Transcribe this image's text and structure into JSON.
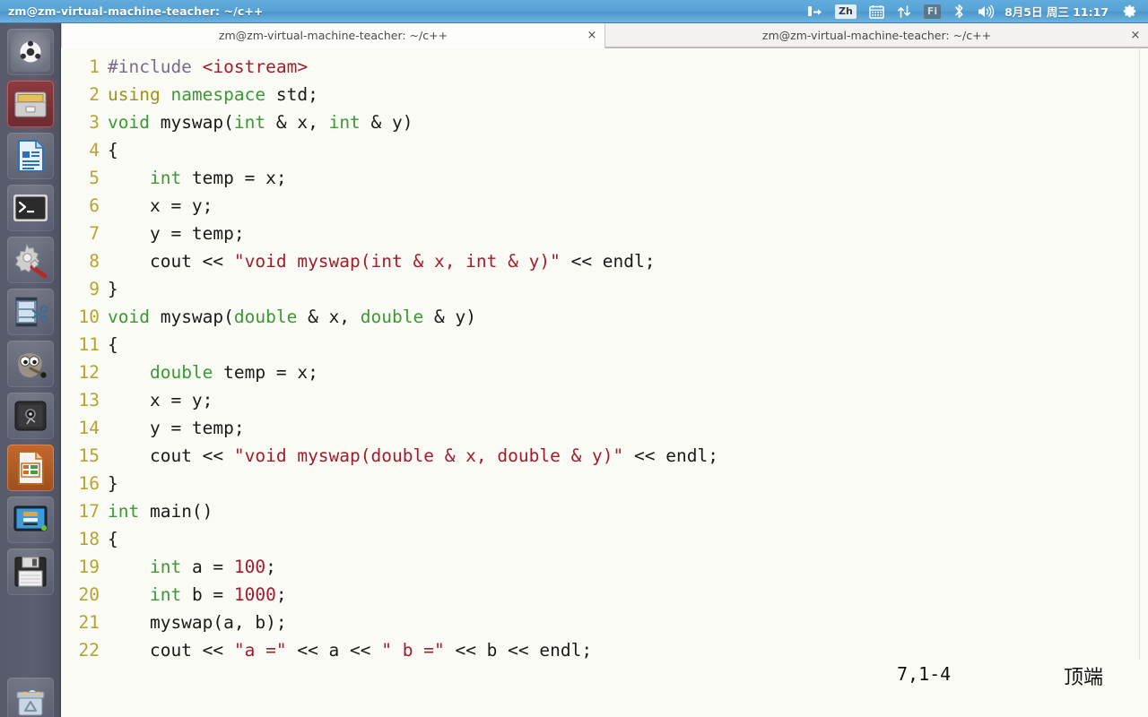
{
  "panel": {
    "window_title": "zm@zm-virtual-machine-teacher: ~/c++",
    "tray": [
      {
        "name": "keyboard-indicator-icon",
        "label": "",
        "kind": "icon"
      },
      {
        "name": "input-method-zh-icon",
        "label": "Zh",
        "kind": "box"
      },
      {
        "name": "calendar-icon",
        "label": "",
        "kind": "icon"
      },
      {
        "name": "network-transfer-icon",
        "label": "",
        "kind": "icon"
      },
      {
        "name": "fcitx-indicator-icon",
        "label": "Fi",
        "kind": "box-dim"
      },
      {
        "name": "bluetooth-icon",
        "label": "",
        "kind": "icon"
      },
      {
        "name": "volume-icon",
        "label": "",
        "kind": "icon"
      }
    ],
    "clock": "8月5日 周三 11:17",
    "session_menu": "gear-icon"
  },
  "launcher": {
    "items": [
      {
        "name": "ubuntu-dash-icon",
        "tooltip": "Dash",
        "state": "normal"
      },
      {
        "name": "files-nautilus-icon",
        "tooltip": "Files",
        "state": "focused"
      },
      {
        "name": "libreoffice-writer-icon",
        "tooltip": "LibreOffice Writer",
        "state": "normal"
      },
      {
        "name": "terminal-icon",
        "tooltip": "Terminal",
        "state": "running"
      },
      {
        "name": "system-settings-icon",
        "tooltip": "System Settings",
        "state": "normal"
      },
      {
        "name": "video-editor-icon",
        "tooltip": "Video Editor",
        "state": "normal"
      },
      {
        "name": "gimp-icon",
        "tooltip": "GIMP",
        "state": "normal"
      },
      {
        "name": "safe-vault-icon",
        "tooltip": "Vault",
        "state": "normal"
      },
      {
        "name": "libreoffice-impress-icon",
        "tooltip": "LibreOffice Impress",
        "state": "focused-orange"
      },
      {
        "name": "remote-desktop-icon",
        "tooltip": "Remote Desktop",
        "state": "normal"
      },
      {
        "name": "floppy-save-icon",
        "tooltip": "Disk",
        "state": "normal"
      },
      {
        "name": "trash-icon",
        "tooltip": "Trash",
        "state": "normal"
      }
    ]
  },
  "terminal": {
    "tabs": [
      {
        "label": "zm@zm-virtual-machine-teacher: ~/c++",
        "active": true,
        "close_label": "×"
      },
      {
        "label": "zm@zm-virtual-machine-teacher: ~/c++",
        "active": false,
        "close_label": "×"
      }
    ],
    "status": {
      "position": "7,1-4",
      "state": "顶端"
    },
    "code_lines": [
      {
        "n": "1",
        "tokens": [
          {
            "t": "#include ",
            "c": "pre"
          },
          {
            "t": "<iostream>",
            "c": "inc"
          }
        ]
      },
      {
        "n": "2",
        "tokens": [
          {
            "t": "using",
            "c": "kw"
          },
          {
            "t": " ",
            "c": "plain"
          },
          {
            "t": "namespace",
            "c": "type"
          },
          {
            "t": " std;",
            "c": "plain"
          }
        ]
      },
      {
        "n": "3",
        "tokens": [
          {
            "t": "void",
            "c": "type"
          },
          {
            "t": " myswap(",
            "c": "plain"
          },
          {
            "t": "int",
            "c": "type"
          },
          {
            "t": " & x, ",
            "c": "plain"
          },
          {
            "t": "int",
            "c": "type"
          },
          {
            "t": " & y)",
            "c": "plain"
          }
        ]
      },
      {
        "n": "4",
        "tokens": [
          {
            "t": "{",
            "c": "plain"
          }
        ]
      },
      {
        "n": "5",
        "tokens": [
          {
            "t": "    ",
            "c": "plain"
          },
          {
            "t": "int",
            "c": "type"
          },
          {
            "t": " temp = x;",
            "c": "plain"
          }
        ]
      },
      {
        "n": "6",
        "tokens": [
          {
            "t": "    x = y;",
            "c": "plain"
          }
        ]
      },
      {
        "n": "7",
        "tokens": [
          {
            "t": "    y = temp;",
            "c": "plain"
          }
        ]
      },
      {
        "n": "8",
        "tokens": [
          {
            "t": "    cout << ",
            "c": "plain"
          },
          {
            "t": "\"void myswap(int & x, int & y)\"",
            "c": "str"
          },
          {
            "t": " << endl;",
            "c": "plain"
          }
        ]
      },
      {
        "n": "9",
        "tokens": [
          {
            "t": "}",
            "c": "plain"
          }
        ]
      },
      {
        "n": "10",
        "tokens": [
          {
            "t": "void",
            "c": "type"
          },
          {
            "t": " myswap(",
            "c": "plain"
          },
          {
            "t": "double",
            "c": "type"
          },
          {
            "t": " & x, ",
            "c": "plain"
          },
          {
            "t": "double",
            "c": "type"
          },
          {
            "t": " & y)",
            "c": "plain"
          }
        ]
      },
      {
        "n": "11",
        "tokens": [
          {
            "t": "{",
            "c": "plain"
          }
        ]
      },
      {
        "n": "12",
        "tokens": [
          {
            "t": "    ",
            "c": "plain"
          },
          {
            "t": "double",
            "c": "type"
          },
          {
            "t": " temp = x;",
            "c": "plain"
          }
        ]
      },
      {
        "n": "13",
        "tokens": [
          {
            "t": "    x = y;",
            "c": "plain"
          }
        ]
      },
      {
        "n": "14",
        "tokens": [
          {
            "t": "    y = temp;",
            "c": "plain"
          }
        ]
      },
      {
        "n": "15",
        "tokens": [
          {
            "t": "    cout << ",
            "c": "plain"
          },
          {
            "t": "\"void myswap(double & x, double & y)\"",
            "c": "str"
          },
          {
            "t": " << endl;",
            "c": "plain"
          }
        ]
      },
      {
        "n": "16",
        "tokens": [
          {
            "t": "}",
            "c": "plain"
          }
        ]
      },
      {
        "n": "17",
        "tokens": [
          {
            "t": "int",
            "c": "type"
          },
          {
            "t": " main()",
            "c": "plain"
          }
        ]
      },
      {
        "n": "18",
        "tokens": [
          {
            "t": "{",
            "c": "plain"
          }
        ]
      },
      {
        "n": "19",
        "tokens": [
          {
            "t": "    ",
            "c": "plain"
          },
          {
            "t": "int",
            "c": "type"
          },
          {
            "t": " a = ",
            "c": "plain"
          },
          {
            "t": "100",
            "c": "num"
          },
          {
            "t": ";",
            "c": "plain"
          }
        ]
      },
      {
        "n": "20",
        "tokens": [
          {
            "t": "    ",
            "c": "plain"
          },
          {
            "t": "int",
            "c": "type"
          },
          {
            "t": " b = ",
            "c": "plain"
          },
          {
            "t": "1000",
            "c": "num"
          },
          {
            "t": ";",
            "c": "plain"
          }
        ]
      },
      {
        "n": "21",
        "tokens": [
          {
            "t": "    myswap(a, b);",
            "c": "plain"
          }
        ]
      },
      {
        "n": "22",
        "tokens": [
          {
            "t": "    cout << ",
            "c": "plain"
          },
          {
            "t": "\"a =\"",
            "c": "str"
          },
          {
            "t": " << a << ",
            "c": "plain"
          },
          {
            "t": "\" b =\"",
            "c": "str"
          },
          {
            "t": " << b << endl;",
            "c": "plain"
          }
        ]
      }
    ]
  },
  "colors": {
    "panel_blue": "#57a4d7",
    "launcher_grey": "#5b5f70",
    "editor_bg": "#fbfbf6",
    "line_number": "#b5a432",
    "type_green": "#3a9a32",
    "string_red": "#a21c2b",
    "keyword_olive": "#a39116"
  }
}
